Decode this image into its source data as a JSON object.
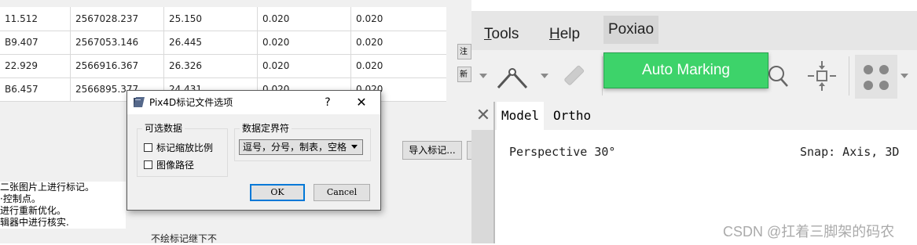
{
  "table": {
    "rows": [
      [
        "11.512",
        "2567028.237",
        "25.150",
        "0.020",
        "0.020"
      ],
      [
        "B9.407",
        "2567053.146",
        "26.445",
        "0.020",
        "0.020"
      ],
      [
        "22.929",
        "2566916.367",
        "26.326",
        "0.020",
        "0.020"
      ],
      [
        "B6.457",
        "2566895.377",
        "24.431",
        "0.020",
        "0.020"
      ]
    ]
  },
  "left_panel": {
    "side_button_1": "注",
    "side_button_2": "新",
    "import_button": "导入标记...",
    "instructions": [
      "二张图片上进行标记。",
      "·控制点。",
      "进行重新优化。",
      "辑器中进行核实."
    ],
    "clipped_note": "不绘标记继下不"
  },
  "dialog": {
    "title": "Pix4D标记文件选项",
    "help": "?",
    "close": "✕",
    "optional_group": "可选数据",
    "checkbox_scale": "标记缩放比例",
    "checkbox_path": "图像路径",
    "delimiter_group": "数据定界符",
    "delimiter_value": "逗号，分号，制表，空格",
    "ok": "OK",
    "cancel": "Cancel"
  },
  "menubar": {
    "tools": "Tools",
    "help": "Help",
    "poxiao": "Poxiao"
  },
  "popup": {
    "label": "Auto Marking"
  },
  "tabs": {
    "close": "✕",
    "model": "Model",
    "ortho": "Ortho"
  },
  "viewport": {
    "perspective": "Perspective 30°",
    "snap": "Snap: Axis, 3D"
  },
  "watermark": "CSDN @扛着三脚架的码农",
  "colors": {
    "accent_green": "#3dd36a",
    "ok_border": "#0078d7"
  }
}
